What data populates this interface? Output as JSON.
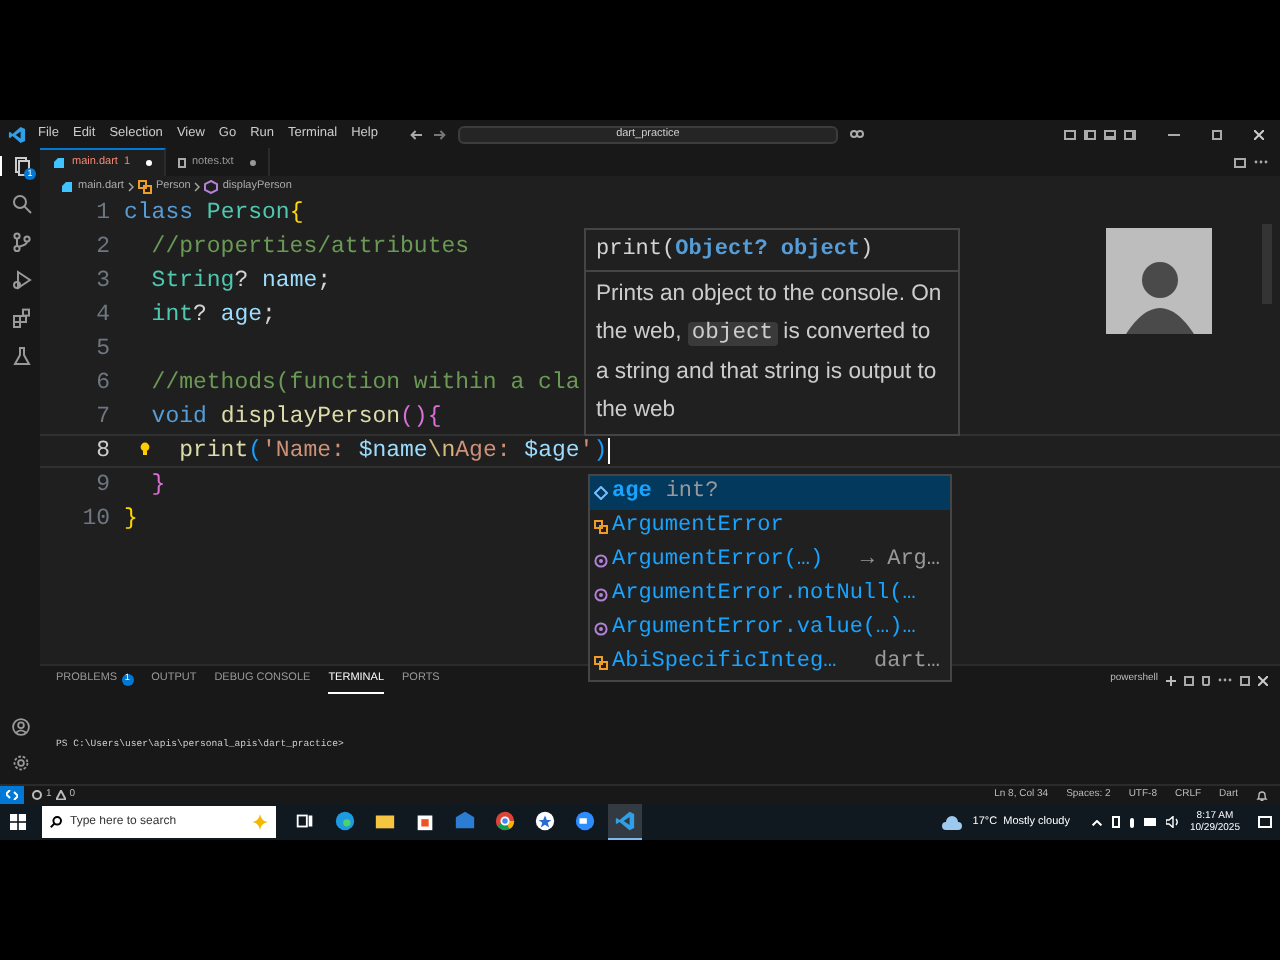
{
  "title_bar": {
    "menus": [
      "File",
      "Edit",
      "Selection",
      "View",
      "Go",
      "Run",
      "Terminal",
      "Help"
    ],
    "search": "dart_practice"
  },
  "activity_bar": {
    "items": [
      {
        "kind": "explorer",
        "badge": "1",
        "selected": true
      },
      {
        "kind": "search",
        "selected": false
      },
      {
        "kind": "source-control",
        "selected": false
      },
      {
        "kind": "run",
        "selected": false
      },
      {
        "kind": "extensions",
        "selected": false
      },
      {
        "kind": "testing",
        "selected": false
      }
    ]
  },
  "tabs": [
    {
      "label": "main.dart",
      "count": "1",
      "selected": true,
      "kind": "dart"
    },
    {
      "label": "notes.txt",
      "selected": false,
      "kind": "text"
    }
  ],
  "breadcrumbs": [
    {
      "label": "main.dart",
      "kind": "file"
    },
    {
      "label": "Person",
      "kind": "class"
    },
    {
      "label": "displayPerson",
      "kind": "method"
    }
  ],
  "editor": {
    "lines": [
      {
        "number": "1",
        "current": false,
        "tokens": [
          {
            "text": "class ",
            "kind": "keyword"
          },
          {
            "text": "Person",
            "kind": "type"
          },
          {
            "text": "{",
            "kind": "bracket"
          }
        ]
      },
      {
        "number": "2",
        "current": false,
        "tokens": [
          {
            "text": "  //properties/attributes",
            "kind": "comment"
          }
        ]
      },
      {
        "number": "3",
        "current": false,
        "tokens": [
          {
            "text": "  String",
            "kind": "type"
          },
          {
            "text": "? ",
            "kind": "plain"
          },
          {
            "text": "name",
            "kind": "ident"
          },
          {
            "text": ";",
            "kind": "plain"
          }
        ]
      },
      {
        "number": "4",
        "current": false,
        "tokens": [
          {
            "text": "  int",
            "kind": "type"
          },
          {
            "text": "? ",
            "kind": "plain"
          },
          {
            "text": "age",
            "kind": "ident"
          },
          {
            "text": ";",
            "kind": "plain"
          }
        ]
      },
      {
        "number": "5",
        "current": false
      },
      {
        "number": "6",
        "current": false,
        "tokens": [
          {
            "text": "  //methods(function within a cla",
            "kind": "comment"
          }
        ]
      },
      {
        "number": "7",
        "current": false,
        "tokens": [
          {
            "text": "  void ",
            "kind": "keyword"
          },
          {
            "text": "displayPerson",
            "kind": "func"
          },
          {
            "text": "(){",
            "kind": "bracket2"
          }
        ]
      },
      {
        "number": "8",
        "current": true,
        "tokens": [
          {
            "text": "    print",
            "kind": "func"
          },
          {
            "text": "(",
            "kind": "bracket3"
          },
          {
            "text": "'Name: ",
            "kind": "string"
          },
          {
            "text": "$name",
            "kind": "ident"
          },
          {
            "text": "\\n",
            "kind": "escape"
          },
          {
            "text": "Age: ",
            "kind": "string"
          },
          {
            "text": "$age",
            "kind": "ident"
          },
          {
            "text": "'",
            "kind": "string"
          },
          {
            "text": ")",
            "kind": "bracket3"
          }
        ]
      },
      {
        "number": "9",
        "current": false,
        "tokens": [
          {
            "text": "  }",
            "kind": "bracket2"
          }
        ]
      },
      {
        "number": "10",
        "current": false,
        "tokens": [
          {
            "text": "}",
            "kind": "bracket"
          }
        ]
      }
    ],
    "hover": {
      "signature": [
        {
          "text": "print(",
          "kind": "plain"
        },
        {
          "text": "Object? object",
          "kind": "param"
        },
        {
          "text": ")",
          "kind": "plain"
        }
      ],
      "description": [
        {
          "text": "Prints an object to the console. On the web, ",
          "kind": "text"
        },
        {
          "text": "object",
          "kind": "code"
        },
        {
          "text": " is converted to a string and that string is output to the web",
          "kind": "text"
        }
      ]
    },
    "suggestions": [
      {
        "label": "age",
        "detail": "int?",
        "kind": "field",
        "selected": true
      },
      {
        "label": "ArgumentError",
        "kind": "class",
        "selected": false
      },
      {
        "label": "ArgumentError(…)",
        "detail": "→ Arg…",
        "kind": "constructor",
        "selected": false
      },
      {
        "label": "ArgumentError.notNull(…",
        "kind": "constructor",
        "selected": false
      },
      {
        "label": "ArgumentError.value(…)…",
        "kind": "constructor",
        "selected": false
      },
      {
        "label": "AbiSpecificInteg…",
        "detail": "dart…",
        "kind": "class",
        "selected": false
      }
    ]
  },
  "panel": {
    "tabs": [
      {
        "label": "PROBLEMS",
        "badge": "1",
        "selected": false
      },
      {
        "label": "OUTPUT",
        "selected": false
      },
      {
        "label": "DEBUG CONSOLE",
        "selected": false
      },
      {
        "label": "TERMINAL",
        "selected": true
      },
      {
        "label": "PORTS",
        "selected": false
      }
    ],
    "shell": "powershell",
    "terminal_line": "PS C:\\Users\\user\\apis\\personal_apis\\dart_practice>"
  },
  "status_bar": {
    "errors": "1",
    "warnings": "0",
    "items": [
      "Ln 8, Col 34",
      "Spaces: 2",
      "UTF-8",
      "CRLF",
      "Dart"
    ]
  },
  "taskbar": {
    "search_placeholder": "Type here to search",
    "apps": [
      {
        "kind": "task-view",
        "active": false
      },
      {
        "kind": "edge",
        "active": false
      },
      {
        "kind": "folder",
        "active": false
      },
      {
        "kind": "store",
        "active": false
      },
      {
        "kind": "mail",
        "active": false
      },
      {
        "kind": "chrome",
        "active": false
      },
      {
        "kind": "star",
        "active": false
      },
      {
        "kind": "zoom",
        "active": false
      },
      {
        "kind": "vscode",
        "active": true
      }
    ],
    "weather": "17°C  Mostly cloudy",
    "time": "8:17 AM",
    "date": "10/29/2025"
  }
}
